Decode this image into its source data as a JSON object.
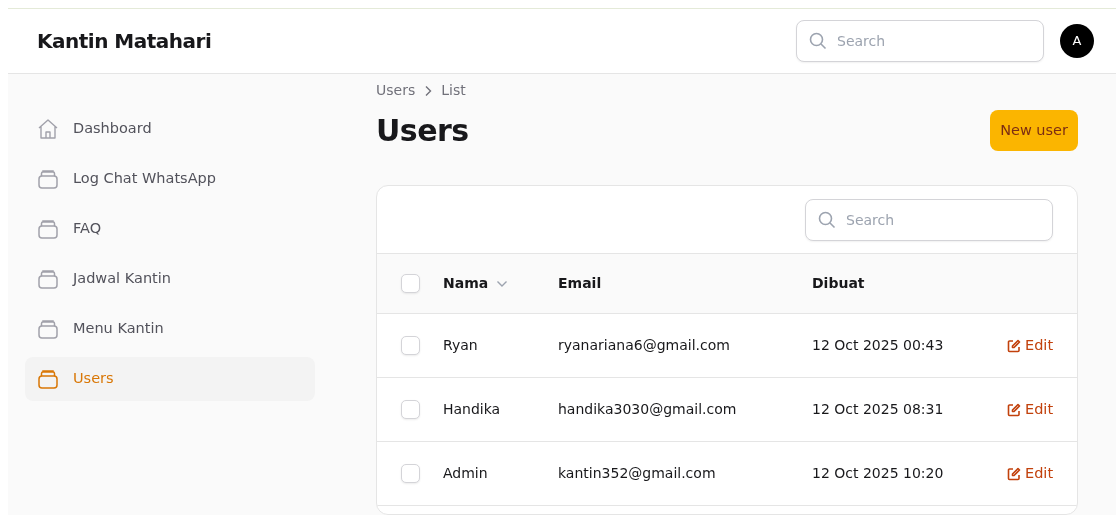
{
  "app": {
    "title": "Kantin Matahari",
    "search_placeholder": "Search",
    "avatar": "A"
  },
  "sidebar": {
    "items": [
      {
        "label": "Dashboard",
        "kind": "home",
        "selected": false
      },
      {
        "label": "Log Chat WhatsApp",
        "kind": "stack",
        "selected": false
      },
      {
        "label": "FAQ",
        "kind": "stack",
        "selected": false
      },
      {
        "label": "Jadwal Kantin",
        "kind": "stack",
        "selected": false
      },
      {
        "label": "Menu Kantin",
        "kind": "stack",
        "selected": false
      },
      {
        "label": "Users",
        "kind": "stack",
        "selected": true
      }
    ]
  },
  "breadcrumb": [
    "Users",
    "List"
  ],
  "page_title": "Users",
  "new_button": "New user",
  "table": {
    "search_placeholder": "Search",
    "columns": [
      {
        "label": "Nama",
        "sortable": true
      },
      {
        "label": "Email",
        "sortable": false
      },
      {
        "label": "Dibuat",
        "sortable": false
      }
    ],
    "header_checked": false,
    "rows": [
      {
        "checked": false,
        "cells": [
          "Ryan",
          "ryanariana6@gmail.com",
          "12 Oct 2025 00:43"
        ],
        "action": "Edit"
      },
      {
        "checked": false,
        "cells": [
          "Handika",
          "handika3030@gmail.com",
          "12 Oct 2025 08:31"
        ],
        "action": "Edit"
      },
      {
        "checked": false,
        "cells": [
          "Admin",
          "kantin352@gmail.com",
          "12 Oct 2025 10:20"
        ],
        "action": "Edit"
      }
    ]
  }
}
